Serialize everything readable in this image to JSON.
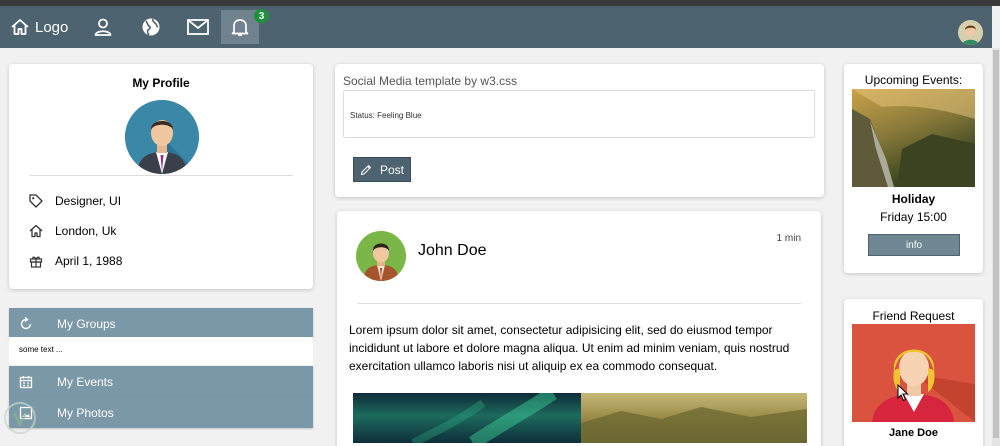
{
  "navbar": {
    "logo_label": "Logo",
    "notification_count": "3"
  },
  "profile": {
    "title": "My Profile",
    "job": "Designer, UI",
    "location": "London, Uk",
    "birthday": "April 1, 1988"
  },
  "accordion": {
    "groups_label": "My Groups",
    "groups_text": "some text ...",
    "events_label": "My Events",
    "photos_label": "My Photos"
  },
  "status_card": {
    "title": "Social Media template by w3.css",
    "status_text": "Status: Feeling Blue",
    "post_label": "Post"
  },
  "post": {
    "author": "John Doe",
    "time": "1 min",
    "body": "Lorem ipsum dolor sit amet, consectetur adipisicing elit, sed do eiusmod tempor incididunt ut labore et dolore magna aliqua. Ut enim ad minim veniam, quis nostrud exercitation ullamco laboris nisi ut aliquip ex ea commodo consequat."
  },
  "events": {
    "title": "Upcoming Events:",
    "name": "Holiday",
    "date": "Friday 15:00",
    "info_label": "info"
  },
  "friend_request": {
    "title": "Friend Request",
    "name": "Jane Doe"
  },
  "colors": {
    "navbar": "#4d636f",
    "accordion": "#7a98a7",
    "badge": "#1f8f3a"
  }
}
